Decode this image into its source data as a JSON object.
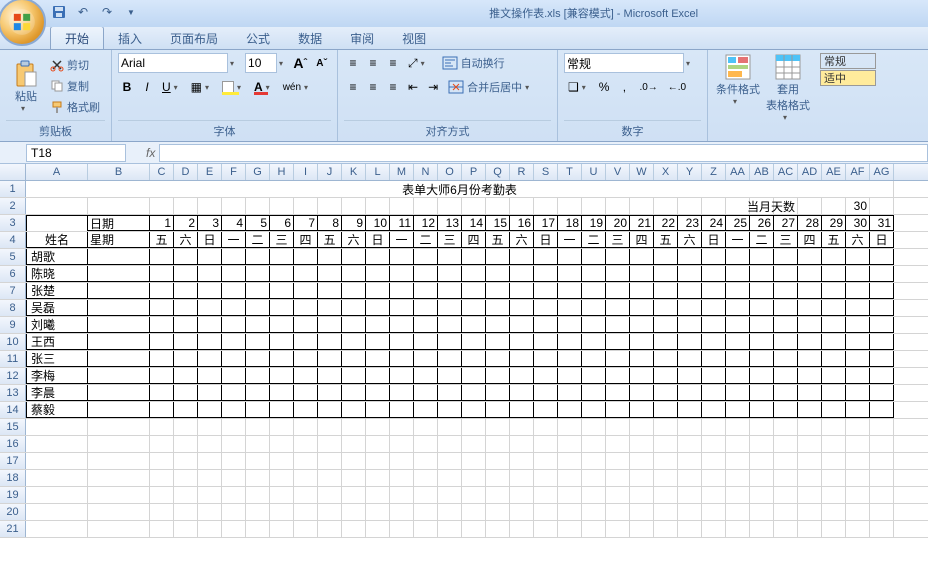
{
  "app": {
    "title": "推文操作表.xls  [兼容模式] - Microsoft Excel"
  },
  "tabs": [
    "开始",
    "插入",
    "页面布局",
    "公式",
    "数据",
    "审阅",
    "视图"
  ],
  "active_tab": 0,
  "ribbon": {
    "clipboard": {
      "label": "剪贴板",
      "paste": "粘贴",
      "cut": "剪切",
      "copy": "复制",
      "format_painter": "格式刷"
    },
    "font": {
      "label": "字体",
      "name": "Arial",
      "size": "10"
    },
    "alignment": {
      "label": "对齐方式",
      "wrap": "自动换行",
      "merge": "合并后居中"
    },
    "number": {
      "label": "数字",
      "format": "常规"
    },
    "styles": {
      "cond": "条件格式",
      "table": "套用\n表格格式",
      "normal": "常规",
      "good": "适中"
    }
  },
  "namebox": "T18",
  "formula": "",
  "cols": [
    "A",
    "B",
    "C",
    "D",
    "E",
    "F",
    "G",
    "H",
    "I",
    "J",
    "K",
    "L",
    "M",
    "N",
    "O",
    "P",
    "Q",
    "R",
    "S",
    "T",
    "U",
    "V",
    "W",
    "X",
    "Y",
    "Z",
    "AA",
    "AB",
    "AC",
    "AD",
    "AE",
    "AF",
    "AG"
  ],
  "col_widths": {
    "A": 62,
    "B": 62,
    "rest": 24
  },
  "sheet": {
    "title": "表单大师6月份考勤表",
    "days_label": "当月天数",
    "days_value": "30",
    "name_label": "姓名",
    "date_label": "日期",
    "weekday_label": "星期",
    "dates": [
      "1",
      "2",
      "3",
      "4",
      "5",
      "6",
      "7",
      "8",
      "9",
      "10",
      "11",
      "12",
      "13",
      "14",
      "15",
      "16",
      "17",
      "18",
      "19",
      "20",
      "21",
      "22",
      "23",
      "24",
      "25",
      "26",
      "27",
      "28",
      "29",
      "30",
      "31"
    ],
    "weekdays": [
      "五",
      "六",
      "日",
      "一",
      "二",
      "三",
      "四",
      "五",
      "六",
      "日",
      "一",
      "二",
      "三",
      "四",
      "五",
      "六",
      "日",
      "一",
      "二",
      "三",
      "四",
      "五",
      "六",
      "日",
      "一",
      "二",
      "三",
      "四",
      "五",
      "六",
      "日"
    ],
    "names": [
      "胡歌",
      "陈晓",
      "张楚",
      "吴磊",
      "刘曦",
      "王西",
      "张三",
      "李梅",
      "李晨",
      "蔡毅"
    ]
  },
  "visible_rows": 21
}
